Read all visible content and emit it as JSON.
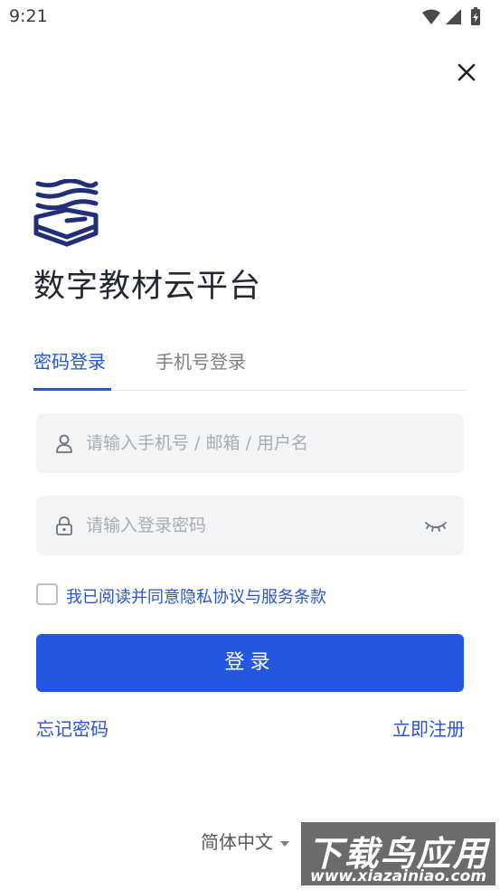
{
  "status_bar": {
    "time": "9:21"
  },
  "app": {
    "title": "数字教材云平台"
  },
  "tabs": [
    {
      "label": "密码登录",
      "active": true
    },
    {
      "label": "手机号登录",
      "active": false
    }
  ],
  "form": {
    "account_placeholder": "请输入手机号 / 邮箱 / 用户名",
    "password_placeholder": "请输入登录密码",
    "agreement_text": "我已阅读并同意隐私协议与服务条款",
    "login_label": "登录"
  },
  "links": {
    "forgot": "忘记密码",
    "register": "立即注册"
  },
  "language": {
    "selected": "简体中文"
  },
  "watermark": {
    "big": "下载鸟应用",
    "small": "www.xiazainiao.com"
  },
  "colors": {
    "primary": "#2357e0",
    "link": "#2b55c8",
    "field_bg": "#f3f4f6",
    "logo": "#232e7a"
  }
}
